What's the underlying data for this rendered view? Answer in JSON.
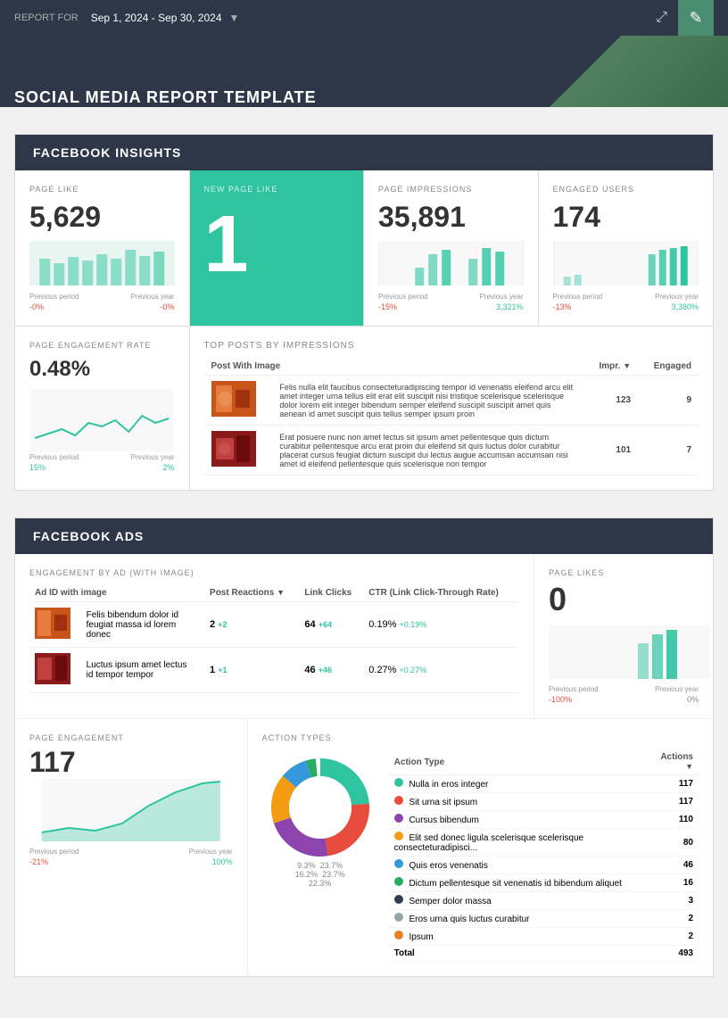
{
  "header": {
    "report_for_label": "REPORT FOR",
    "date_range": "Sep 1, 2024 - Sep 30, 2024",
    "share_icon": "⤢",
    "edit_icon": "✎"
  },
  "title": "SOCIAL MEDIA REPORT TEMPLATE",
  "facebook_insights": {
    "section_label": "FACEBOOK INSIGHTS",
    "page_like": {
      "label": "PAGE LIKE",
      "value": "5,629",
      "prev_period_label": "Previous period",
      "prev_year_label": "Previous year",
      "change_period": "-0%",
      "change_year": "-0%"
    },
    "new_page_like": {
      "label": "NEW PAGE LIKE",
      "value": "1"
    },
    "page_impressions": {
      "label": "PAGE IMPRESSIONS",
      "value": "35,891",
      "prev_period_label": "Previous period",
      "prev_year_label": "Previous year",
      "change_period": "-15%",
      "change_year": "3,321%"
    },
    "engaged_users": {
      "label": "ENGAGED USERS",
      "value": "174",
      "prev_period_label": "Previous period",
      "prev_year_label": "Previous year",
      "change_period": "-13%",
      "change_year": "3,380%"
    },
    "page_engagement_rate": {
      "label": "PAGE ENGAGEMENT RATE",
      "value": "0.48%",
      "prev_period_label": "Previous period",
      "prev_year_label": "Previous year",
      "change_period": "15%",
      "change_year": "2%"
    },
    "top_posts": {
      "label": "TOP POSTS BY IMPRESSIONS",
      "col_post": "Post With Image",
      "col_impr": "Impr.",
      "col_engaged": "Engaged",
      "posts": [
        {
          "text": "Felis nulla elit faucibus consecteturadipiscing tempor id venenatis eleifend arcu elit amet integer urna tellus elit erat elit suscipit nisi tristique scelerisque scelerisque dolor lorem elit integer bibendum semper eleifend suscipit suscipit amet quis aenean id amet suscipit quis tellus semper ipsum proin",
          "impr": "123",
          "engaged": "9",
          "color": "#c8541a"
        },
        {
          "text": "Erat posuere nunc non amet lectus sit ipsum amet pellentesque quis dictum curabitur pellentesque arcu erat proin dui eleifend sit quis luctus dolor curabitur placerat cursus feugiat dictum suscipit dui lectus augue accumsan accumsan nisi amet id eleifend pellentesque quis scelerisque non tempor",
          "impr": "101",
          "engaged": "7",
          "color": "#8b1a1a"
        }
      ]
    }
  },
  "facebook_ads": {
    "section_label": "FACEBOOK ADS",
    "engagement_label": "ENGAGEMENT BY AD (WITH IMAGE)",
    "col_ad": "Ad ID with image",
    "col_reactions": "Post Reactions",
    "col_clicks": "Link Clicks",
    "col_ctr": "CTR (Link Click-Through Rate)",
    "ads": [
      {
        "name": "Felis bibendum dolor id feugiat massa id lorem donec",
        "reactions": "2",
        "reactions_delta": "+2",
        "clicks": "64",
        "clicks_delta": "+64",
        "ctr": "0.19%",
        "ctr_delta": "+0.19%",
        "color": "#c8541a"
      },
      {
        "name": "Luctus ipsum amet lectus id tempor tempor",
        "reactions": "1",
        "reactions_delta": "+1",
        "clicks": "46",
        "clicks_delta": "+46",
        "ctr": "0.27%",
        "ctr_delta": "+0.27%",
        "color": "#8b1a1a"
      }
    ],
    "page_likes": {
      "label": "PAGE LIKES",
      "value": "0",
      "prev_period_label": "Previous period",
      "prev_year_label": "Previous year",
      "change_period": "-100%",
      "change_year": "0%"
    },
    "page_engagement": {
      "label": "PAGE ENGAGEMENT",
      "value": "117",
      "prev_period_label": "Previous period",
      "prev_year_label": "Previous year",
      "change_period": "-21%",
      "change_year": "100%"
    },
    "action_types": {
      "label": "ACTION TYPES",
      "col_type": "Action Type",
      "col_actions": "Actions",
      "rows": [
        {
          "label": "Nulla in eros integer",
          "value": "117",
          "color": "#2ec4a0"
        },
        {
          "label": "Sit urna sit ipsum",
          "value": "117",
          "color": "#e74c3c"
        },
        {
          "label": "Cursus bibendum",
          "value": "110",
          "color": "#8e44ad"
        },
        {
          "label": "Elit sed donec ligula scelerisque scelerisque consecteturadipisci...",
          "value": "80",
          "color": "#f39c12"
        },
        {
          "label": "Quis eros venenatis",
          "value": "46",
          "color": "#3498db"
        },
        {
          "label": "Dictum pellentesque sit venenatis id bibendum aliquet",
          "value": "16",
          "color": "#27ae60"
        },
        {
          "label": "Semper dolor massa",
          "value": "3",
          "color": "#2c3e50"
        },
        {
          "label": "Eros urna quis luctus curabitur",
          "value": "2",
          "color": "#95a5a6"
        },
        {
          "label": "Ipsum",
          "value": "2",
          "color": "#e67e22"
        }
      ],
      "total_label": "Total",
      "total_value": "493"
    }
  }
}
